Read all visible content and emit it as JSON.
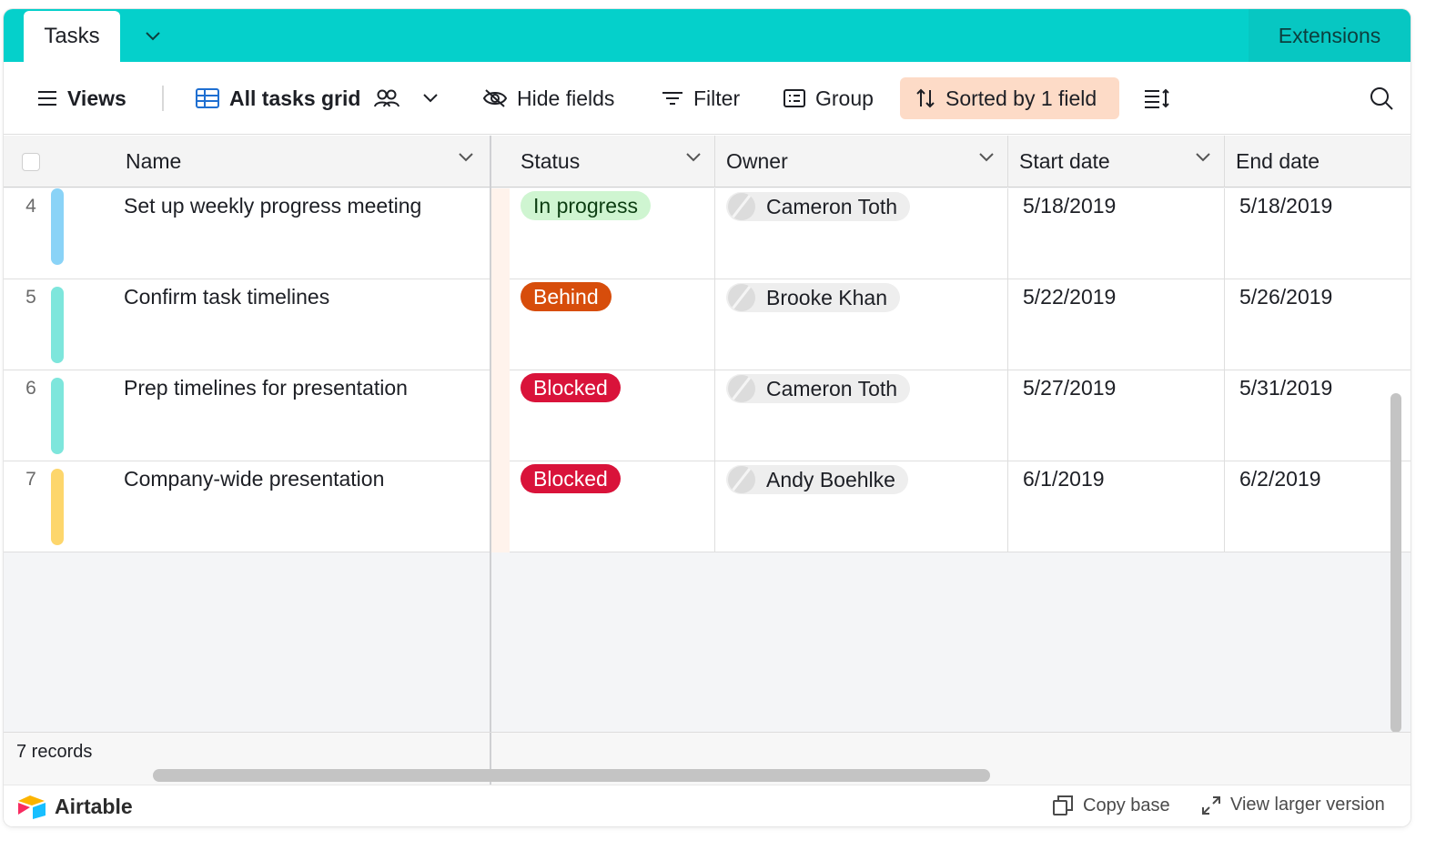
{
  "tabs": {
    "active": "Tasks",
    "extensions": "Extensions"
  },
  "toolbar": {
    "views": "Views",
    "grid_view": "All tasks grid",
    "hide_fields": "Hide fields",
    "filter": "Filter",
    "group": "Group",
    "sorted": "Sorted by 1 field"
  },
  "columns": {
    "name": "Name",
    "status": "Status",
    "owner": "Owner",
    "start_date": "Start date",
    "end_date": "End date"
  },
  "rows": [
    {
      "num": "4",
      "bar_color": "#8ad3f7",
      "name": "Set up weekly progress meeting",
      "status": "In progress",
      "status_bg": "#cff5d1",
      "status_fg": "#0b3d11",
      "owner": "Cameron Toth",
      "start": "5/18/2019",
      "end": "5/18/2019"
    },
    {
      "num": "5",
      "bar_color": "#7ee6dc",
      "name": "Confirm task timelines",
      "status": "Behind",
      "status_bg": "#d74d0b",
      "status_fg": "#ffffff",
      "owner": "Brooke Khan",
      "start": "5/22/2019",
      "end": "5/26/2019"
    },
    {
      "num": "6",
      "bar_color": "#7ee6dc",
      "name": "Prep timelines for presentation",
      "status": "Blocked",
      "status_bg": "#d9133a",
      "status_fg": "#ffffff",
      "owner": "Cameron Toth",
      "start": "5/27/2019",
      "end": "5/31/2019"
    },
    {
      "num": "7",
      "bar_color": "#fdd66c",
      "name": "Company-wide presentation",
      "status": "Blocked",
      "status_bg": "#d9133a",
      "status_fg": "#ffffff",
      "owner": "Andy Boehlke",
      "start": "6/1/2019",
      "end": "6/2/2019"
    }
  ],
  "footer": {
    "records": "7 records"
  },
  "bottom": {
    "brand": "Airtable",
    "copy_base": "Copy base",
    "view_larger": "View larger version"
  },
  "colors": {
    "teal": "#05d0cb",
    "sort_highlight": "#fddbc7"
  }
}
